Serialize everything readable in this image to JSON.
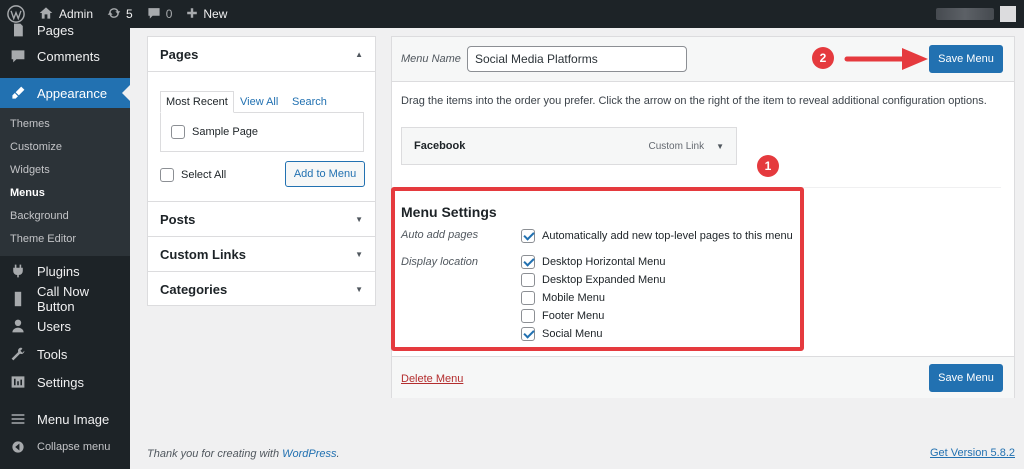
{
  "adminbar": {
    "site_name": "Admin",
    "updates_count": "5",
    "comments_count": "0",
    "new_label": "New"
  },
  "sidebar": {
    "items": [
      {
        "label": "Pages",
        "icon": "pages-icon"
      },
      {
        "label": "Comments",
        "icon": "comments-icon"
      },
      {
        "label": "Appearance",
        "icon": "appearance-icon"
      },
      {
        "label": "Plugins",
        "icon": "plugins-icon"
      },
      {
        "label": "Call Now Button",
        "icon": "phone-icon"
      },
      {
        "label": "Users",
        "icon": "users-icon"
      },
      {
        "label": "Tools",
        "icon": "tools-icon"
      },
      {
        "label": "Settings",
        "icon": "settings-icon"
      },
      {
        "label": "Menu Image",
        "icon": "menu-icon"
      },
      {
        "label": "Collapse menu",
        "icon": "collapse-icon"
      }
    ],
    "submenu": [
      "Themes",
      "Customize",
      "Widgets",
      "Menus",
      "Background",
      "Theme Editor"
    ]
  },
  "left_panel": {
    "pages_title": "Pages",
    "tabs": [
      "Most Recent",
      "View All",
      "Search"
    ],
    "sample_page": "Sample Page",
    "select_all": "Select All",
    "add_to_menu": "Add to Menu",
    "sections": [
      "Posts",
      "Custom Links",
      "Categories"
    ]
  },
  "editor": {
    "menu_name_label": "Menu Name",
    "menu_name_value": "Social Media Platforms",
    "save_label": "Save Menu",
    "instructions": "Drag the items into the order you prefer. Click the arrow on the right of the item to reveal additional configuration options.",
    "menu_item": {
      "title": "Facebook",
      "type": "Custom Link"
    },
    "settings_title": "Menu Settings",
    "auto_add_label": "Auto add pages",
    "auto_add_option": "Automatically add new top-level pages to this menu",
    "display_location_label": "Display location",
    "locations": [
      {
        "label": "Desktop Horizontal Menu",
        "checked": true
      },
      {
        "label": "Desktop Expanded Menu",
        "checked": false
      },
      {
        "label": "Mobile Menu",
        "checked": false
      },
      {
        "label": "Footer Menu",
        "checked": false
      },
      {
        "label": "Social Menu",
        "checked": true
      }
    ],
    "delete_label": "Delete Menu"
  },
  "annotations": {
    "badge_1": "1",
    "badge_2": "2",
    "color": "#e53a3e"
  },
  "footer": {
    "thanks_prefix": "Thank you for creating with",
    "wordpress_link": "WordPress",
    "thanks_suffix": ".",
    "version": "Get Version 5.8.2"
  }
}
